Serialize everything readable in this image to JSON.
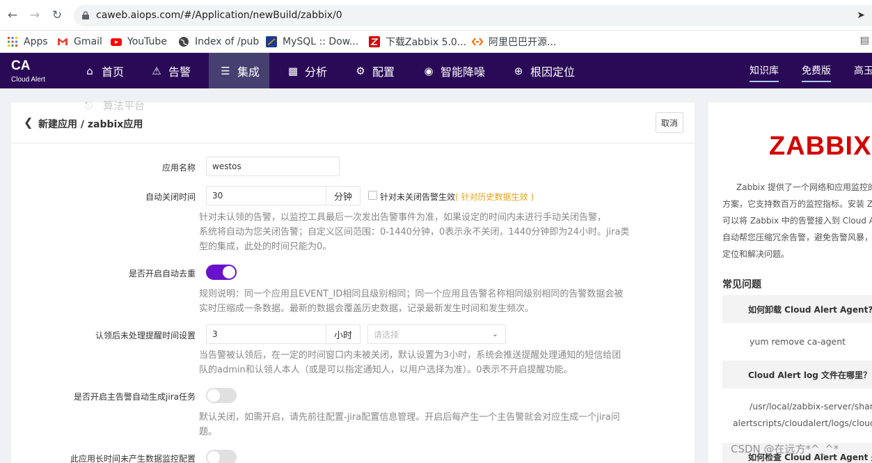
{
  "browser": {
    "url": "caweb.aiops.com/#/Application/newBuild/zabbix/0",
    "bookmarks": [
      {
        "label": "Apps",
        "icon": "apps-grid-icon"
      },
      {
        "label": "Gmail",
        "icon": "gmail-icon"
      },
      {
        "label": "YouTube",
        "icon": "youtube-icon"
      },
      {
        "label": "Index of /pub",
        "icon": "globe-icon"
      },
      {
        "label": "MySQL :: Dow...",
        "icon": "mysql-icon"
      },
      {
        "label": "下载Zabbix 5.0...",
        "icon": "zabbix-bookmark-icon"
      },
      {
        "label": "阿里巴巴开源...",
        "icon": "alibaba-icon"
      }
    ]
  },
  "header": {
    "logo": "CA",
    "logo_sub": "Cloud Alert",
    "nav": [
      {
        "label": "首页",
        "icon": "home-icon"
      },
      {
        "label": "告警",
        "icon": "alarm-icon"
      },
      {
        "label": "集成",
        "icon": "layers-icon",
        "active": true
      },
      {
        "label": "分析",
        "icon": "chart-icon"
      },
      {
        "label": "配置",
        "icon": "gear-icon"
      },
      {
        "label": "智能降噪",
        "icon": "noise-icon"
      },
      {
        "label": "根因定位",
        "icon": "target-icon"
      }
    ],
    "knowledge": "知识库",
    "free": "免费版",
    "user": "高玉"
  },
  "overlay": {
    "algo_platform": "算法平台"
  },
  "form": {
    "title": "新建应用 / zabbix应用",
    "cancel": "取消",
    "app_name": {
      "label": "应用名称",
      "value": "westos"
    },
    "auto_close": {
      "label": "自动关闭时间",
      "value": "30",
      "unit": "分钟",
      "checkbox_label": "针对未关闭告警生效",
      "checkbox_hint": "( 针对历史数据生效 )",
      "help": [
        "针对未认领的告警，以监控工具最后一次发出告警事件为准，如果设定的时间内未进行手动关闭告警，",
        "系统将自动为您关闭告警；自定义区间范围：0-1440分钟，0表示永不关闭，1440分钟即为24小时。jira类",
        "型的集成，此处的时间只能为0。"
      ]
    },
    "dedupe": {
      "label": "是否开启自动去重",
      "on": true,
      "help": [
        "规则说明：同一个应用且EVENT_ID相同且级别相同；同一个应用且告警名称相同级别相同的告警数据会被",
        "实时压缩成一条数据。最新的数据会覆盖历史数据，记录最新发生时间和发生频次。"
      ]
    },
    "remind": {
      "label": "认领后未处理提醒时间设置",
      "value": "3",
      "unit": "小时",
      "select_placeholder": "请选择",
      "help": [
        "当告警被认领后，在一定的时间窗口内未被关闭，默认设置为3小时，系统会推送提醒处理通知的短信给团",
        "队的admin和认领人本人（或是可以指定通知人，以用户选择为准）。0表示不开启提醒功能。"
      ]
    },
    "jira": {
      "label": "是否开启主告警自动生成jira任务",
      "on": false,
      "help": [
        "默认关闭，如需开启，请先前往配置-jira配置信息管理。开启后每产生一个主告警就会对应生成一个jira问",
        "题。"
      ]
    },
    "nodata": {
      "label": "此应用长时间未产生数据监控配置",
      "on": false
    }
  },
  "side": {
    "logo": "ZABBIX",
    "desc": [
      "Zabbix 提供了一个网络和应用监控的",
      "方案，它支持数百万的监控指标。安装 Z",
      "可以将 Zabbix 中的告警接入到 Cloud Ale",
      "自动帮您压缩冗余告警，避免告警风暴，",
      "定位和解决问题。"
    ],
    "faq_title": "常见问题",
    "faqs": [
      {
        "q": "如何卸载 Cloud Alert Agent?",
        "a": [
          "yum remove ca-agent"
        ]
      },
      {
        "q": "Cloud Alert log 文件在哪里？",
        "a": [
          "/usr/local/zabbix-server/share/z",
          "alertscripts/cloudalert/logs/cloudale"
        ]
      },
      {
        "q": "如何检查 Cloud Alert Agent 是否"
      }
    ]
  },
  "watermark": "CSDN @在远方*^_^*"
}
